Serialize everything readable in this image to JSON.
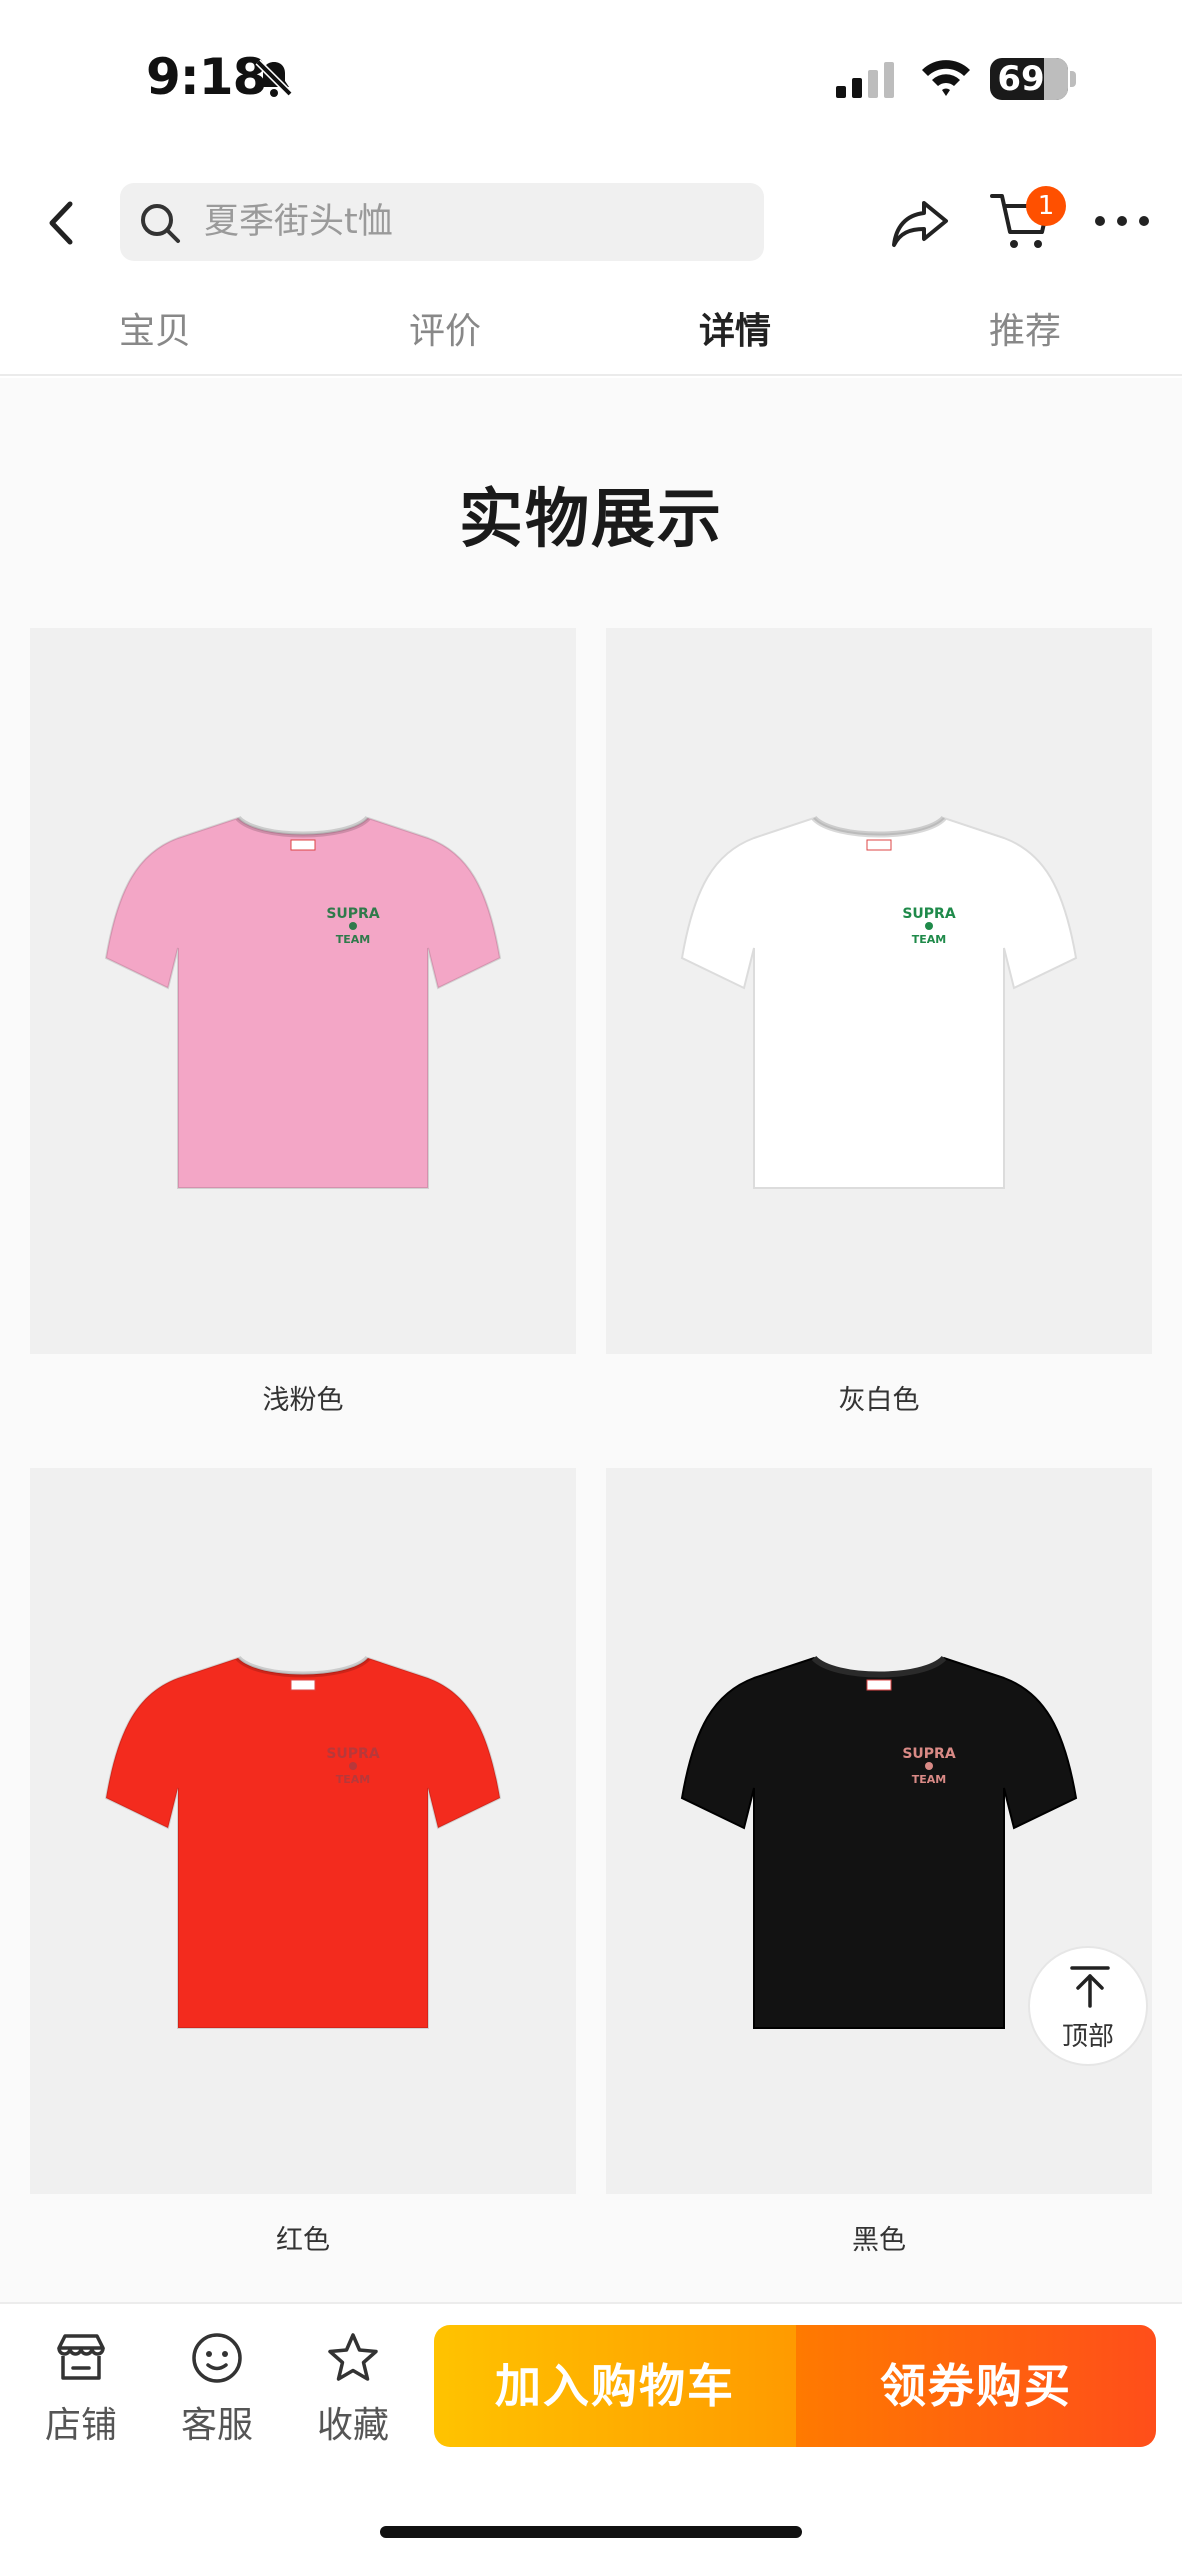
{
  "status_bar": {
    "time": "9:18",
    "battery_level": "69",
    "battery_fraction": 0.69
  },
  "header": {
    "search_placeholder": "夏季街头t恤",
    "cart_badge": "1"
  },
  "tabs": [
    {
      "label": "宝贝",
      "active": false
    },
    {
      "label": "评价",
      "active": false
    },
    {
      "label": "详情",
      "active": true
    },
    {
      "label": "推荐",
      "active": false
    }
  ],
  "content": {
    "section_title": "实物展示",
    "products": [
      {
        "caption": "浅粉色",
        "shirt_color": "#f3a6c6",
        "print_color": "#2f7a4b",
        "print_text": "SUPRA TEAM"
      },
      {
        "caption": "灰白色",
        "shirt_color": "#ffffff",
        "print_color": "#1f8a4a",
        "print_text": "SUPRA TEAM"
      },
      {
        "caption": "红色",
        "shirt_color": "#f32b1e",
        "print_color": "#b8383a",
        "print_text": "SUPRA TEAM"
      },
      {
        "caption": "黑色",
        "shirt_color": "#121212",
        "print_color": "#d98a86",
        "print_text": "SUPRA TEAM"
      }
    ],
    "back_to_top_label": "顶部"
  },
  "bottom_bar": {
    "store_label": "店铺",
    "service_label": "客服",
    "favorite_label": "收藏",
    "add_to_cart_label": "加入购物车",
    "coupon_buy_label": "领券购买",
    "colors": {
      "cart_gradient_start": "#ffc300",
      "cart_gradient_end": "#ff9a00",
      "buy_gradient_start": "#ff7a00",
      "buy_gradient_end": "#ff4e1a",
      "badge": "#ff5000"
    }
  }
}
